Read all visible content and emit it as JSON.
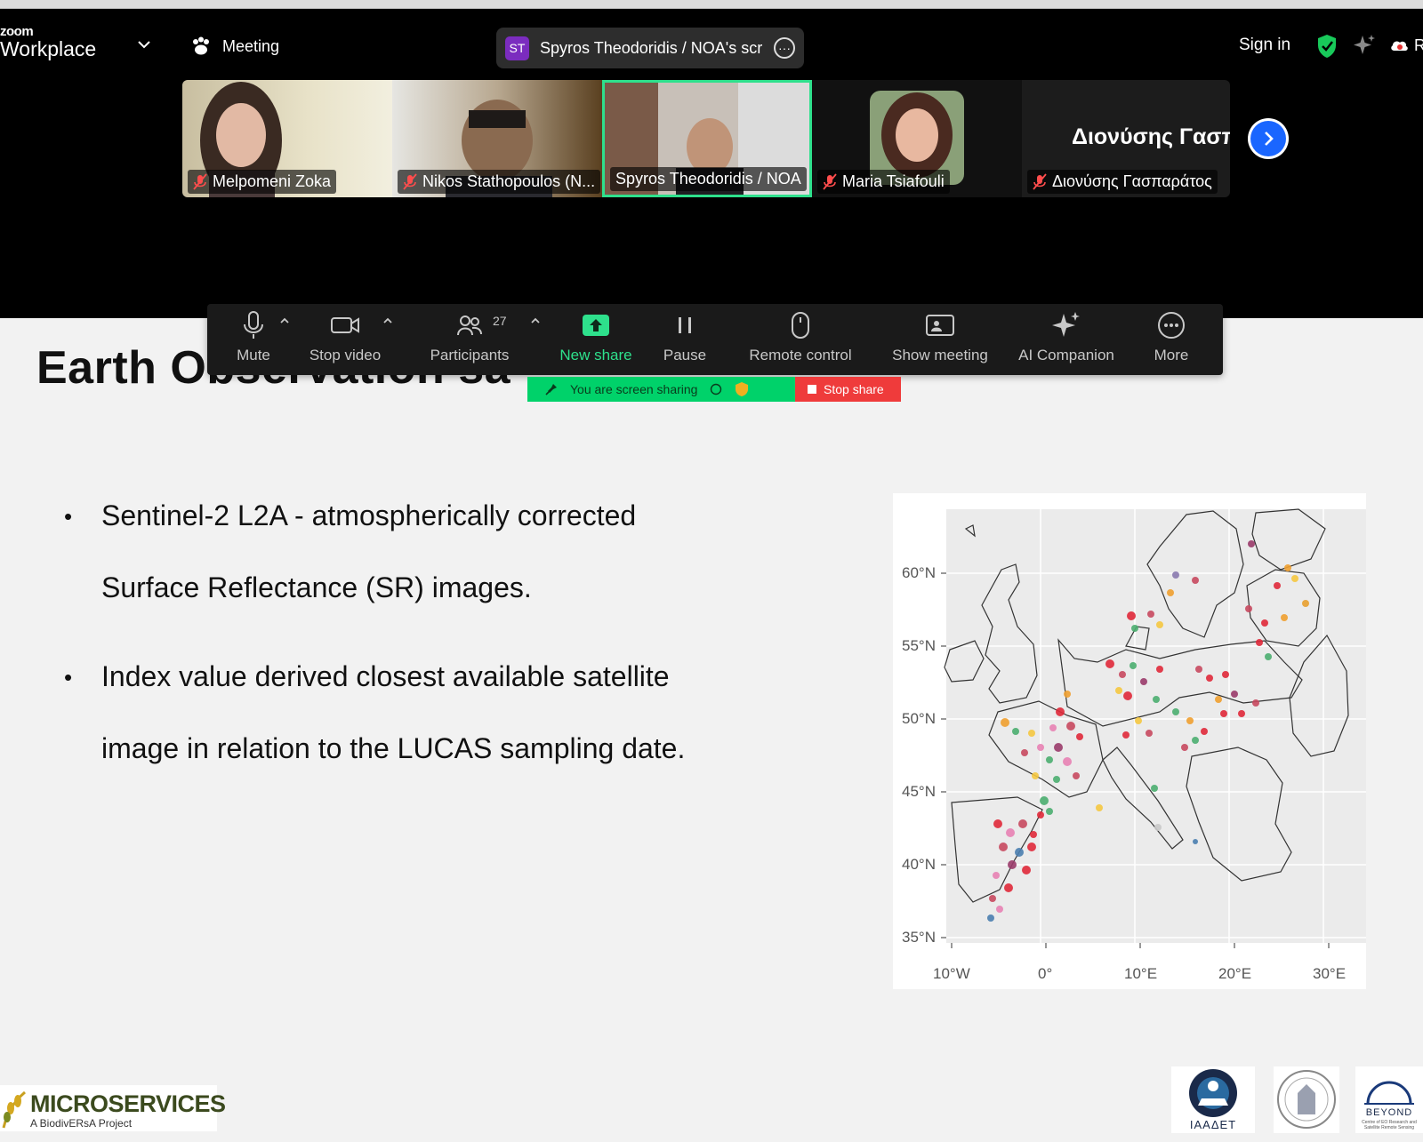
{
  "window": {
    "brand_top": "zoom",
    "brand_bottom": "Workplace",
    "meeting_label": "Meeting",
    "share_title": "Spyros Theodoridis / NOA's scre",
    "share_avatar": "ST",
    "sign_in": "Sign in",
    "edge_letter": "R"
  },
  "participants": [
    {
      "name": "Melpomeni Zoka",
      "muted": true
    },
    {
      "name": "Nikos Stathopoulos (N...",
      "muted": true
    },
    {
      "name": "Spyros Theodoridis / NOA",
      "muted": false,
      "active": true
    },
    {
      "name": "Maria Tsiafouli",
      "muted": true
    },
    {
      "name": "Διονύσης Γασπαράτος",
      "muted": true,
      "big_name": "Διονύσης Γασπ..."
    }
  ],
  "toolbar": {
    "mute": "Mute",
    "stop_video": "Stop video",
    "participants": "Participants",
    "participant_count": "27",
    "new_share": "New share",
    "pause": "Pause",
    "remote_control": "Remote control",
    "show_meeting": "Show meeting",
    "ai_companion": "AI Companion",
    "more": "More"
  },
  "share_bar": {
    "status": "You are screen sharing",
    "stop": "Stop share"
  },
  "slide": {
    "title": "Earth Observation sa",
    "bullets": [
      {
        "line1": "Sentinel-2 L2A - atmospherically corrected",
        "line2": "Surface Reflectance (SR) images."
      },
      {
        "line1": "Index value derived closest available satellite",
        "line2": "image in relation to the LUCAS sampling date."
      }
    ],
    "map": {
      "y_ticks": [
        "60°N",
        "55°N",
        "50°N",
        "45°N",
        "40°N",
        "35°N"
      ],
      "x_ticks": [
        "10°W",
        "0°",
        "10°E",
        "20°E",
        "30°E"
      ]
    },
    "logos": {
      "microservices": "MICROSERVICES",
      "microservices_sub": "A BiodivERsA Project",
      "iaadet": "ΙΑΑΔΕΤ",
      "beyond": "BEYOND",
      "beyond_sub": "Centre of EO Research and Satellite Remote Sensing"
    }
  },
  "colors": {
    "accent_green": "#2ee08c",
    "share_green": "#00d26a",
    "stop_red": "#ef3b3b",
    "next_blue": "#1a66ff"
  }
}
